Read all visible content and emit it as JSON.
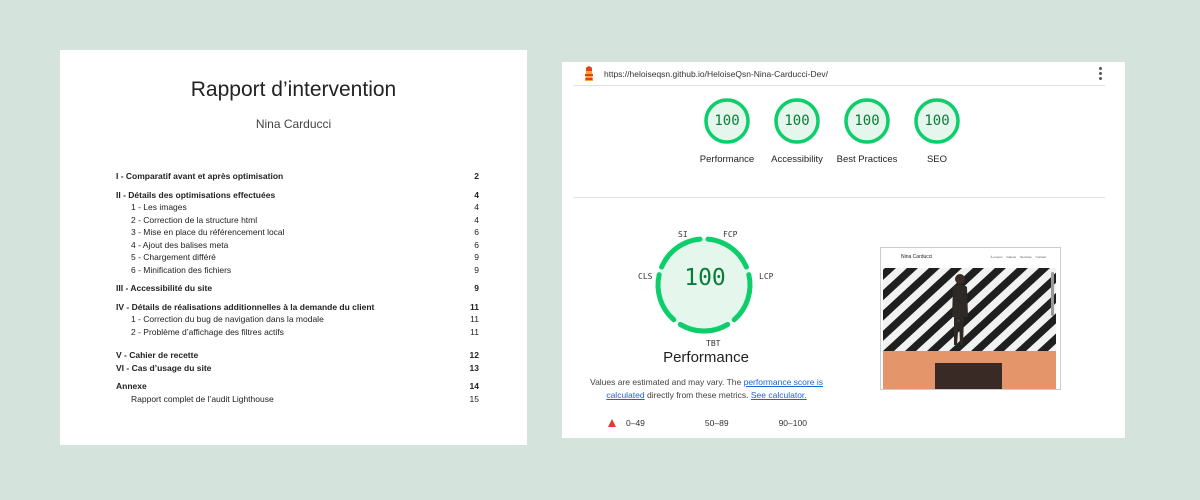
{
  "report": {
    "title": "Rapport d’intervention",
    "author": "Nina Carducci",
    "toc": [
      {
        "label": "I - Comparatif avant et après optimisation",
        "page": "2",
        "level": "section"
      },
      {
        "label": "II - Détails des optimisations effectuées",
        "page": "4",
        "level": "section"
      },
      {
        "label": "1 - Les images",
        "page": "4",
        "level": "sub"
      },
      {
        "label": "2 - Correction de la structure html",
        "page": "4",
        "level": "sub"
      },
      {
        "label": "3 - Mise en place du référencement local",
        "page": "6",
        "level": "sub"
      },
      {
        "label": "4 - Ajout des balises meta",
        "page": "6",
        "level": "sub"
      },
      {
        "label": "5 - Chargement différé",
        "page": "9",
        "level": "sub"
      },
      {
        "label": "6 - Minification des fichiers",
        "page": "9",
        "level": "sub"
      },
      {
        "label": "III - Accessibilité du site",
        "page": "9",
        "level": "section"
      },
      {
        "label": "IV - Détails de réalisations additionnelles à la demande du client",
        "page": "11",
        "level": "section"
      },
      {
        "label": "1 - Correction du bug de navigation dans la modale",
        "page": "11",
        "level": "sub"
      },
      {
        "label": "2 - Problème d’affichage des filtres actifs",
        "page": "11",
        "level": "sub"
      },
      {
        "label": "V - Cahier de recette",
        "page": "12",
        "level": "section"
      },
      {
        "label": "VI - Cas d’usage du site",
        "page": "13",
        "level": "section"
      },
      {
        "label": "Annexe",
        "page": "14",
        "level": "section"
      },
      {
        "label": "Rapport complet de l’audit Lighthouse",
        "page": "15",
        "level": "sub"
      }
    ]
  },
  "lighthouse": {
    "url": "https://heloiseqsn.github.io/HeloiseQsn-Nina-Carducci-Dev/",
    "icon_lighthouse": "lighthouse-icon",
    "icon_menu": "more-vert-icon",
    "colors": {
      "pass": "#0cce6b",
      "pass_text": "#0a7c3a",
      "pass_fill": "#e5f7ec",
      "fail": "#e23b2e",
      "link": "#1a64d6"
    },
    "categories": [
      {
        "score": "100",
        "label": "Performance",
        "fraction": 1.0
      },
      {
        "score": "100",
        "label": "Accessibility",
        "fraction": 1.0
      },
      {
        "score": "100",
        "label": "Best Practices",
        "fraction": 1.0
      },
      {
        "score": "100",
        "label": "SEO",
        "fraction": 1.0
      }
    ],
    "main_score": "100",
    "main_title": "Performance",
    "metrics": {
      "si": "SI",
      "fcp": "FCP",
      "lcp": "LCP",
      "tbt": "TBT",
      "cls": "CLS"
    },
    "note": {
      "text_1": "Values are estimated and may vary. The ",
      "link_1": "performance score is calculated",
      "text_2": " directly from these metrics. ",
      "link_2": "See calculator."
    },
    "legend": {
      "fail": "0–49",
      "average": "50–89",
      "pass": "90–100"
    },
    "preview": {
      "site_name": "Nina Carducci",
      "nav": [
        "À propos",
        "Galerie",
        "Services",
        "Contact"
      ]
    }
  }
}
